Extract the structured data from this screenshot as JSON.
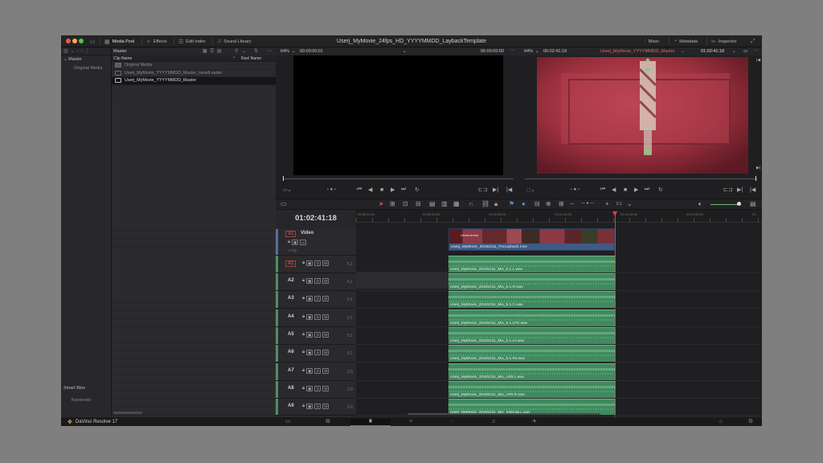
{
  "app": {
    "project_title": "Userj_MyMovie_24fps_HD_YYYYMMDD_LaybackTemplate",
    "brand": "DaVinci Resolve 17"
  },
  "topbar": {
    "media_pool": "Media Pool",
    "effects": "Effects",
    "edit_index": "Edit Index",
    "sound_library": "Sound Library",
    "mixer": "Mixer",
    "metadata": "Metadata",
    "inspector": "Inspector"
  },
  "bins": {
    "header": "Master",
    "master": "Master",
    "original_media": "Original Media",
    "smart_bins": "Smart Bins",
    "keywords": "Keywords"
  },
  "pool": {
    "title": "Master",
    "col_clip_name": "Clip Name",
    "col_reel_name": "Reel Name",
    "clips": [
      {
        "name": "Original Media",
        "icon": "folder-icon"
      },
      {
        "name": "Userj_MyMovie_YYYYMMDD_Master_HeadLeader",
        "icon": "timeline-icon"
      },
      {
        "name": "Userj_MyMovie_YYYYMMDD_Master",
        "icon": "timeline-icon"
      }
    ]
  },
  "source_viewer": {
    "zoom": "64%",
    "timecode_left": "00:00:00:01",
    "timecode_right": "00:00:00:00"
  },
  "timeline_viewer": {
    "zoom": "64%",
    "timecode_left": "00:02:41:19",
    "timeline_name": "Userj_MyMovie_YYYYMMDD_Master",
    "timecode_right": "01:02:41:18"
  },
  "timeline": {
    "current_tc": "01:02:41:18",
    "ruler": [
      "00:58:30:00",
      "00:59:34:00",
      "01:00:38:00",
      "01:01:42:00",
      "01:02:46:00",
      "01:03:50:00",
      "01:"
    ],
    "video_track": {
      "id": "V1",
      "name": "Video",
      "clip_count": "1 Clip",
      "clip_name": "Userj_MyMovie_20181011_ForLayback.mov",
      "clip_overlay": "Urban Armor"
    },
    "audio_tracks": [
      {
        "id": "A1",
        "ch": "5.1",
        "clip": "Userj_MyMovie_20181011_Mix_5.1.L.wav"
      },
      {
        "id": "A2",
        "ch": "5.1",
        "clip": "Userj_MyMovie_20181011_Mix_5.1.R.wav"
      },
      {
        "id": "A3",
        "ch": "5.1",
        "clip": "Userj_MyMovie_20181011_Mix_5.1.C.wav"
      },
      {
        "id": "A4",
        "ch": "5.1",
        "clip": "Userj_MyMovie_20181011_Mix_5.1.LFE.wav"
      },
      {
        "id": "A5",
        "ch": "5.1",
        "clip": "Userj_MyMovie_20181011_Mix_5.1.Ls.wav"
      },
      {
        "id": "A6",
        "ch": "5.1",
        "clip": "Userj_MyMovie_20181011_Mix_5.1.Rs.wav"
      },
      {
        "id": "A7",
        "ch": "2.0",
        "clip": "Userj_MyMovie_20181011_Mix_LtRt.L.wav"
      },
      {
        "id": "A8",
        "ch": "2.0",
        "clip": "Userj_MyMovie_20181011_Mix_LtRt.R.wav"
      },
      {
        "id": "A9",
        "ch": "2.0",
        "clip": "Userj_MyMovie_20181011_Mix_Internat.L.wav"
      }
    ],
    "zoom_value": "0.1"
  }
}
